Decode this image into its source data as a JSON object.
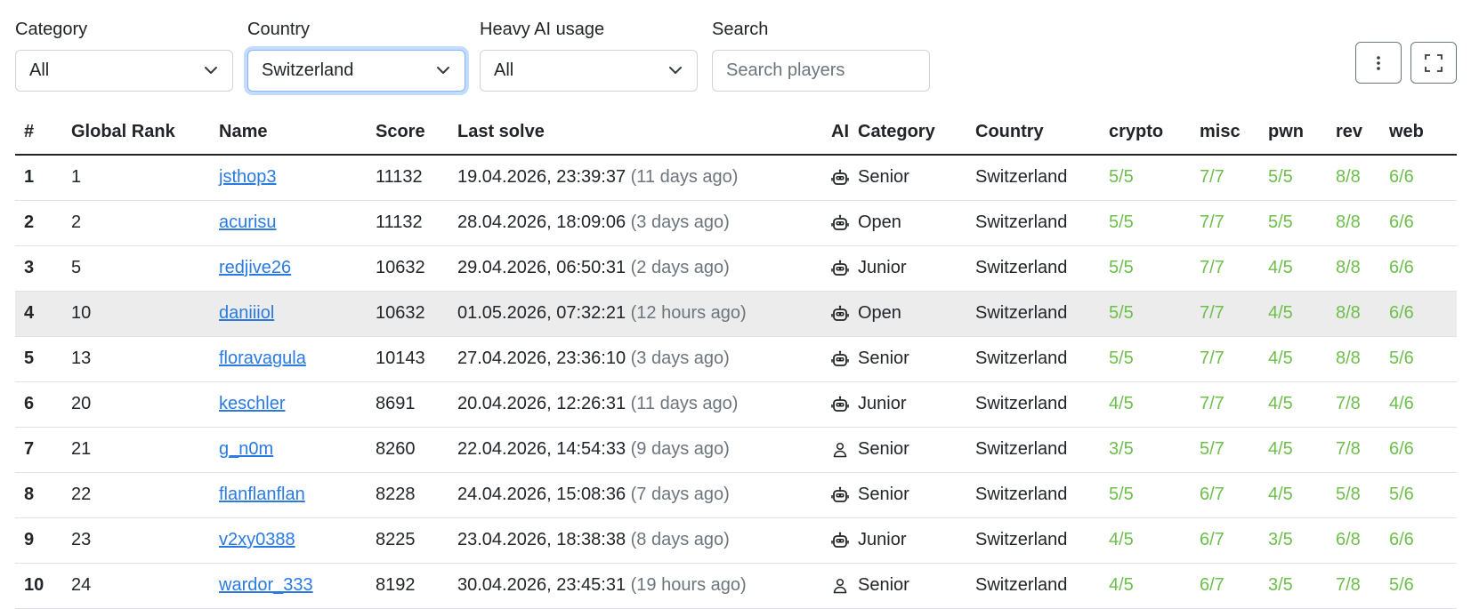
{
  "filters": {
    "category": {
      "label": "Category",
      "value": "All"
    },
    "country": {
      "label": "Country",
      "value": "Switzerland"
    },
    "heavy_ai": {
      "label": "Heavy AI usage",
      "value": "All"
    },
    "search": {
      "label": "Search",
      "placeholder": "Search players"
    }
  },
  "table": {
    "headers": [
      "#",
      "Global Rank",
      "Name",
      "Score",
      "Last solve",
      "AI",
      "Category",
      "Country",
      "crypto",
      "misc",
      "pwn",
      "rev",
      "web"
    ],
    "rows": [
      {
        "num": "1",
        "rank": "1",
        "name": "jsthop3",
        "score": "11132",
        "last": "19.04.2026, 23:39:37",
        "ago": "(11 days ago)",
        "ai": "robot",
        "category": "Senior",
        "country": "Switzerland",
        "crypto": "5/5",
        "misc": "7/7",
        "pwn": "5/5",
        "rev": "8/8",
        "web": "6/6"
      },
      {
        "num": "2",
        "rank": "2",
        "name": "acurisu",
        "score": "11132",
        "last": "28.04.2026, 18:09:06",
        "ago": "(3 days ago)",
        "ai": "robot",
        "category": "Open",
        "country": "Switzerland",
        "crypto": "5/5",
        "misc": "7/7",
        "pwn": "5/5",
        "rev": "8/8",
        "web": "6/6"
      },
      {
        "num": "3",
        "rank": "5",
        "name": "redjive26",
        "score": "10632",
        "last": "29.04.2026, 06:50:31",
        "ago": "(2 days ago)",
        "ai": "robot",
        "category": "Junior",
        "country": "Switzerland",
        "crypto": "5/5",
        "misc": "7/7",
        "pwn": "4/5",
        "rev": "8/8",
        "web": "6/6"
      },
      {
        "num": "4",
        "rank": "10",
        "name": "daniiiol",
        "score": "10632",
        "last": "01.05.2026, 07:32:21",
        "ago": "(12 hours ago)",
        "ai": "robot",
        "category": "Open",
        "country": "Switzerland",
        "crypto": "5/5",
        "misc": "7/7",
        "pwn": "4/5",
        "rev": "8/8",
        "web": "6/6"
      },
      {
        "num": "5",
        "rank": "13",
        "name": "floravagula",
        "score": "10143",
        "last": "27.04.2026, 23:36:10",
        "ago": "(3 days ago)",
        "ai": "robot",
        "category": "Senior",
        "country": "Switzerland",
        "crypto": "5/5",
        "misc": "7/7",
        "pwn": "4/5",
        "rev": "8/8",
        "web": "5/6"
      },
      {
        "num": "6",
        "rank": "20",
        "name": "keschler",
        "score": "8691",
        "last": "20.04.2026, 12:26:31",
        "ago": "(11 days ago)",
        "ai": "robot",
        "category": "Junior",
        "country": "Switzerland",
        "crypto": "4/5",
        "misc": "7/7",
        "pwn": "4/5",
        "rev": "7/8",
        "web": "4/6"
      },
      {
        "num": "7",
        "rank": "21",
        "name": "g_n0m",
        "score": "8260",
        "last": "22.04.2026, 14:54:33",
        "ago": "(9 days ago)",
        "ai": "person",
        "category": "Senior",
        "country": "Switzerland",
        "crypto": "3/5",
        "misc": "5/7",
        "pwn": "4/5",
        "rev": "7/8",
        "web": "6/6"
      },
      {
        "num": "8",
        "rank": "22",
        "name": "flanflanflan",
        "score": "8228",
        "last": "24.04.2026, 15:08:36",
        "ago": "(7 days ago)",
        "ai": "robot",
        "category": "Senior",
        "country": "Switzerland",
        "crypto": "5/5",
        "misc": "6/7",
        "pwn": "4/5",
        "rev": "5/8",
        "web": "5/6"
      },
      {
        "num": "9",
        "rank": "23",
        "name": "v2xy0388",
        "score": "8225",
        "last": "23.04.2026, 18:38:38",
        "ago": "(8 days ago)",
        "ai": "robot",
        "category": "Junior",
        "country": "Switzerland",
        "crypto": "4/5",
        "misc": "6/7",
        "pwn": "3/5",
        "rev": "6/8",
        "web": "6/6"
      },
      {
        "num": "10",
        "rank": "24",
        "name": "wardor_333",
        "score": "8192",
        "last": "30.04.2026, 23:45:31",
        "ago": "(19 hours ago)",
        "ai": "person",
        "category": "Senior",
        "country": "Switzerland",
        "crypto": "4/5",
        "misc": "6/7",
        "pwn": "3/5",
        "rev": "7/8",
        "web": "5/6"
      }
    ]
  },
  "colors": {
    "solve": "#6dbf4b",
    "link": "#2a7ae2",
    "muted": "#6c757d",
    "highlight_row": "#ececec"
  }
}
